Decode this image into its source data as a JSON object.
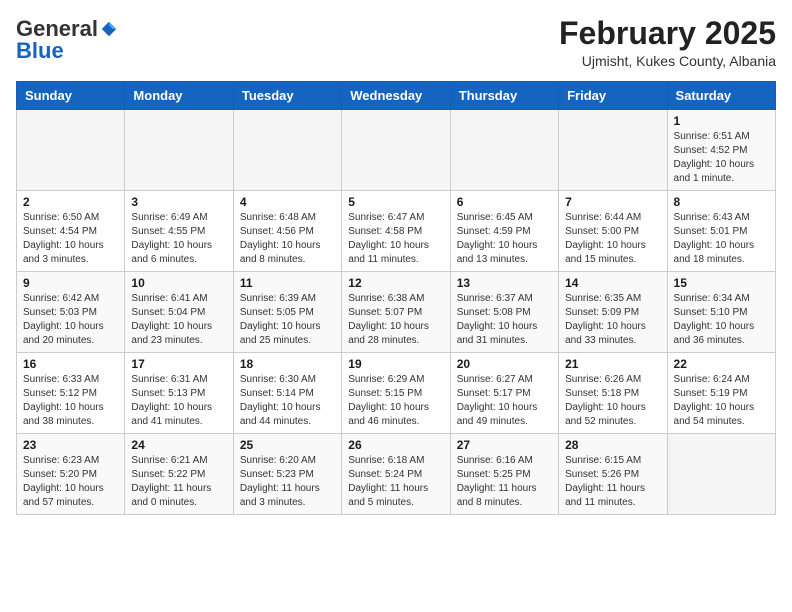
{
  "header": {
    "logo_general": "General",
    "logo_blue": "Blue",
    "month_title": "February 2025",
    "location": "Ujmisht, Kukes County, Albania"
  },
  "days_of_week": [
    "Sunday",
    "Monday",
    "Tuesday",
    "Wednesday",
    "Thursday",
    "Friday",
    "Saturday"
  ],
  "weeks": [
    [
      {
        "day": "",
        "info": ""
      },
      {
        "day": "",
        "info": ""
      },
      {
        "day": "",
        "info": ""
      },
      {
        "day": "",
        "info": ""
      },
      {
        "day": "",
        "info": ""
      },
      {
        "day": "",
        "info": ""
      },
      {
        "day": "1",
        "info": "Sunrise: 6:51 AM\nSunset: 4:52 PM\nDaylight: 10 hours and 1 minute."
      }
    ],
    [
      {
        "day": "2",
        "info": "Sunrise: 6:50 AM\nSunset: 4:54 PM\nDaylight: 10 hours and 3 minutes."
      },
      {
        "day": "3",
        "info": "Sunrise: 6:49 AM\nSunset: 4:55 PM\nDaylight: 10 hours and 6 minutes."
      },
      {
        "day": "4",
        "info": "Sunrise: 6:48 AM\nSunset: 4:56 PM\nDaylight: 10 hours and 8 minutes."
      },
      {
        "day": "5",
        "info": "Sunrise: 6:47 AM\nSunset: 4:58 PM\nDaylight: 10 hours and 11 minutes."
      },
      {
        "day": "6",
        "info": "Sunrise: 6:45 AM\nSunset: 4:59 PM\nDaylight: 10 hours and 13 minutes."
      },
      {
        "day": "7",
        "info": "Sunrise: 6:44 AM\nSunset: 5:00 PM\nDaylight: 10 hours and 15 minutes."
      },
      {
        "day": "8",
        "info": "Sunrise: 6:43 AM\nSunset: 5:01 PM\nDaylight: 10 hours and 18 minutes."
      }
    ],
    [
      {
        "day": "9",
        "info": "Sunrise: 6:42 AM\nSunset: 5:03 PM\nDaylight: 10 hours and 20 minutes."
      },
      {
        "day": "10",
        "info": "Sunrise: 6:41 AM\nSunset: 5:04 PM\nDaylight: 10 hours and 23 minutes."
      },
      {
        "day": "11",
        "info": "Sunrise: 6:39 AM\nSunset: 5:05 PM\nDaylight: 10 hours and 25 minutes."
      },
      {
        "day": "12",
        "info": "Sunrise: 6:38 AM\nSunset: 5:07 PM\nDaylight: 10 hours and 28 minutes."
      },
      {
        "day": "13",
        "info": "Sunrise: 6:37 AM\nSunset: 5:08 PM\nDaylight: 10 hours and 31 minutes."
      },
      {
        "day": "14",
        "info": "Sunrise: 6:35 AM\nSunset: 5:09 PM\nDaylight: 10 hours and 33 minutes."
      },
      {
        "day": "15",
        "info": "Sunrise: 6:34 AM\nSunset: 5:10 PM\nDaylight: 10 hours and 36 minutes."
      }
    ],
    [
      {
        "day": "16",
        "info": "Sunrise: 6:33 AM\nSunset: 5:12 PM\nDaylight: 10 hours and 38 minutes."
      },
      {
        "day": "17",
        "info": "Sunrise: 6:31 AM\nSunset: 5:13 PM\nDaylight: 10 hours and 41 minutes."
      },
      {
        "day": "18",
        "info": "Sunrise: 6:30 AM\nSunset: 5:14 PM\nDaylight: 10 hours and 44 minutes."
      },
      {
        "day": "19",
        "info": "Sunrise: 6:29 AM\nSunset: 5:15 PM\nDaylight: 10 hours and 46 minutes."
      },
      {
        "day": "20",
        "info": "Sunrise: 6:27 AM\nSunset: 5:17 PM\nDaylight: 10 hours and 49 minutes."
      },
      {
        "day": "21",
        "info": "Sunrise: 6:26 AM\nSunset: 5:18 PM\nDaylight: 10 hours and 52 minutes."
      },
      {
        "day": "22",
        "info": "Sunrise: 6:24 AM\nSunset: 5:19 PM\nDaylight: 10 hours and 54 minutes."
      }
    ],
    [
      {
        "day": "23",
        "info": "Sunrise: 6:23 AM\nSunset: 5:20 PM\nDaylight: 10 hours and 57 minutes."
      },
      {
        "day": "24",
        "info": "Sunrise: 6:21 AM\nSunset: 5:22 PM\nDaylight: 11 hours and 0 minutes."
      },
      {
        "day": "25",
        "info": "Sunrise: 6:20 AM\nSunset: 5:23 PM\nDaylight: 11 hours and 3 minutes."
      },
      {
        "day": "26",
        "info": "Sunrise: 6:18 AM\nSunset: 5:24 PM\nDaylight: 11 hours and 5 minutes."
      },
      {
        "day": "27",
        "info": "Sunrise: 6:16 AM\nSunset: 5:25 PM\nDaylight: 11 hours and 8 minutes."
      },
      {
        "day": "28",
        "info": "Sunrise: 6:15 AM\nSunset: 5:26 PM\nDaylight: 11 hours and 11 minutes."
      },
      {
        "day": "",
        "info": ""
      }
    ]
  ]
}
